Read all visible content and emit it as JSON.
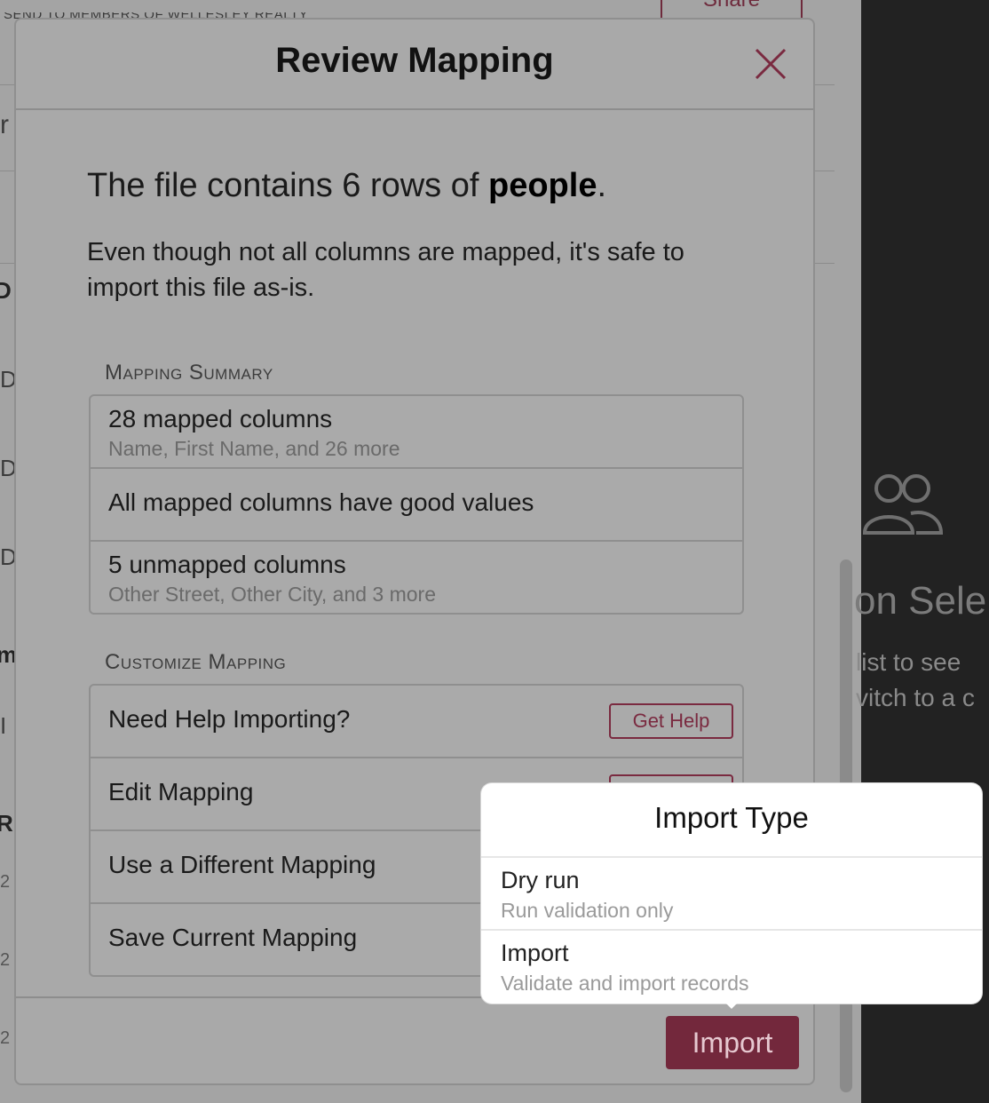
{
  "background": {
    "top_text": "SEND TO MEMBERS OF WELLESLEY REALTY",
    "share_label": "Share",
    "right_panel_text": "on Sele",
    "right_panel_line1": "list to see",
    "right_panel_line2": "vitch to a c"
  },
  "modal": {
    "title": "Review Mapping",
    "summary_prefix": "The file contains 6 rows of ",
    "summary_bold": "people",
    "summary_suffix": ".",
    "safe_text": "Even though not all columns are mapped, it's safe to import this file as-is.",
    "mapping_summary": {
      "heading": "Mapping Summary",
      "rows": [
        {
          "primary": "28 mapped columns",
          "secondary": "Name, First Name, and 26 more"
        },
        {
          "primary": "All mapped columns have good values",
          "secondary": ""
        },
        {
          "primary": "5 unmapped columns",
          "secondary": "Other Street, Other City, and 3 more"
        }
      ]
    },
    "customize_mapping": {
      "heading": "Customize Mapping",
      "rows": [
        {
          "label": "Need Help Importing?",
          "button": "Get Help"
        },
        {
          "label": "Edit Mapping"
        },
        {
          "label": "Use a Different Mapping"
        },
        {
          "label": "Save Current Mapping"
        }
      ]
    },
    "import_button": "Import"
  },
  "popover": {
    "title": "Import Type",
    "options": [
      {
        "label": "Dry run",
        "description": "Run validation only"
      },
      {
        "label": "Import",
        "description": "Validate and import records"
      }
    ]
  }
}
